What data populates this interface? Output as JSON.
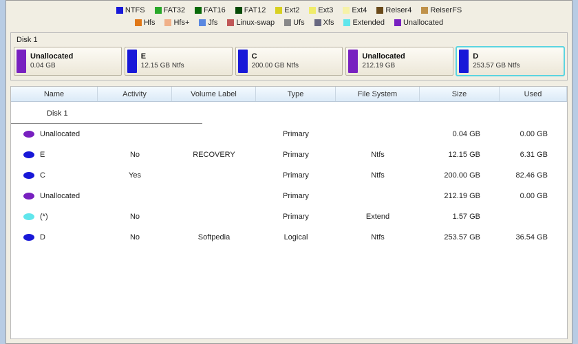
{
  "legend": {
    "row1": [
      {
        "label": "NTFS",
        "color": "#1818d8"
      },
      {
        "label": "FAT32",
        "color": "#2aa82a"
      },
      {
        "label": "FAT16",
        "color": "#0a6a0a"
      },
      {
        "label": "FAT12",
        "color": "#064a06"
      },
      {
        "label": "Ext2",
        "color": "#d8d020"
      },
      {
        "label": "Ext3",
        "color": "#f0ec6a"
      },
      {
        "label": "Ext4",
        "color": "#f6f2a8"
      },
      {
        "label": "Reiser4",
        "color": "#6a4a1a"
      },
      {
        "label": "ReiserFS",
        "color": "#c0924a"
      }
    ],
    "row2": [
      {
        "label": "Hfs",
        "color": "#e07818"
      },
      {
        "label": "Hfs+",
        "color": "#f0b088"
      },
      {
        "label": "Jfs",
        "color": "#5a88e0"
      },
      {
        "label": "Linux-swap",
        "color": "#c05858"
      },
      {
        "label": "Ufs",
        "color": "#888888"
      },
      {
        "label": "Xfs",
        "color": "#686880"
      },
      {
        "label": "Extended",
        "color": "#60e6ec"
      },
      {
        "label": "Unallocated",
        "color": "#7820c0"
      }
    ]
  },
  "disk_panel": {
    "label": "Disk 1",
    "partitions": [
      {
        "title": "Unallocated",
        "sub": "0.04 GB",
        "color": "#7820c0",
        "selected": false
      },
      {
        "title": "E",
        "sub": "12.15 GB Ntfs",
        "color": "#1818d8",
        "selected": false
      },
      {
        "title": "C",
        "sub": "200.00 GB Ntfs",
        "color": "#1818d8",
        "selected": false
      },
      {
        "title": "Unallocated",
        "sub": "212.19 GB",
        "color": "#7820c0",
        "selected": false
      },
      {
        "title": "D",
        "sub": "253.57 GB Ntfs",
        "color": "#1818d8",
        "selected": true
      }
    ]
  },
  "table": {
    "headers": {
      "name": "Name",
      "activity": "Activity",
      "volume_label": "Volume Label",
      "type": "Type",
      "file_system": "File System",
      "size": "Size",
      "used": "Used"
    },
    "group_label": "Disk 1",
    "rows": [
      {
        "icon_color": "#7820c0",
        "name": "Unallocated",
        "activity": "",
        "volume_label": "",
        "type": "Primary",
        "file_system": "",
        "size": "0.04 GB",
        "used": "0.00 GB"
      },
      {
        "icon_color": "#1818d8",
        "name": "E",
        "activity": "No",
        "volume_label": "RECOVERY",
        "type": "Primary",
        "file_system": "Ntfs",
        "size": "12.15 GB",
        "used": "6.31 GB"
      },
      {
        "icon_color": "#1818d8",
        "name": "C",
        "activity": "Yes",
        "volume_label": "",
        "type": "Primary",
        "file_system": "Ntfs",
        "size": "200.00 GB",
        "used": "82.46 GB"
      },
      {
        "icon_color": "#7820c0",
        "name": "Unallocated",
        "activity": "",
        "volume_label": "",
        "type": "Primary",
        "file_system": "",
        "size": "212.19 GB",
        "used": "0.00 GB"
      },
      {
        "icon_color": "#60e6ec",
        "name": "(*)",
        "activity": "No",
        "volume_label": "",
        "type": "Primary",
        "file_system": "Extend",
        "size": "1.57 GB",
        "used": ""
      },
      {
        "icon_color": "#1818d8",
        "name": "D",
        "activity": "No",
        "volume_label": "Softpedia",
        "type": "Logical",
        "file_system": "Ntfs",
        "size": "253.57 GB",
        "used": "36.54 GB"
      }
    ]
  }
}
